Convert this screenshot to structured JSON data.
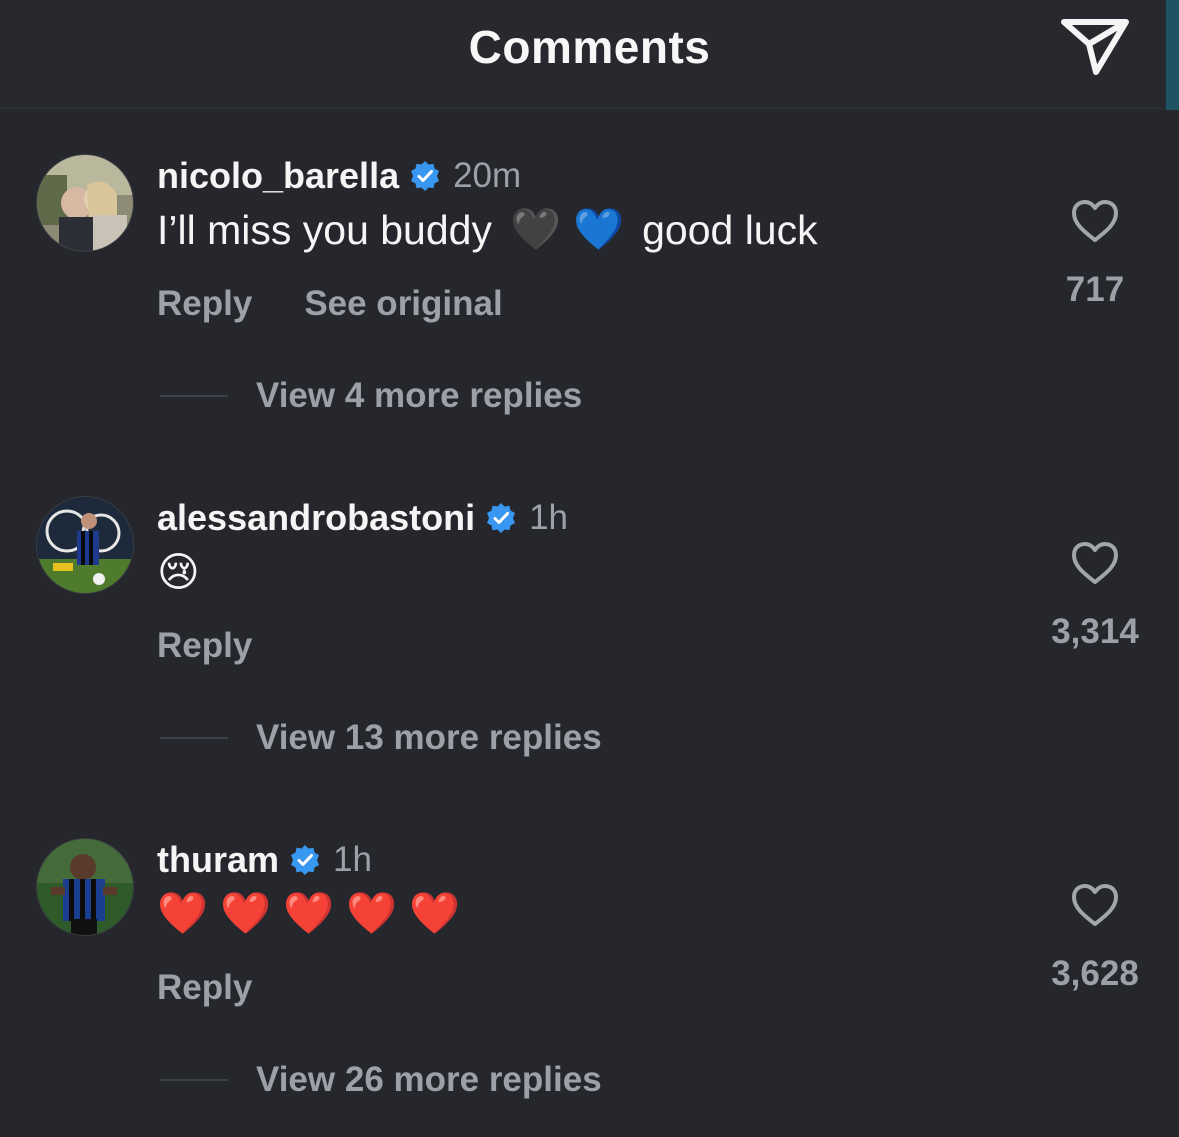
{
  "header": {
    "title": "Comments",
    "share_icon": "paper-plane-icon"
  },
  "colors": {
    "background": "#25272c",
    "muted_text": "#9da1a7",
    "verified_blue": "#3897f0",
    "text": "#f5f5f5"
  },
  "comments": [
    {
      "username": "nicolo_barella",
      "verified": true,
      "time": "20m",
      "text": "I’ll miss you buddy",
      "emojis": [
        "🖤",
        "💙"
      ],
      "text_after": "good luck",
      "actions": {
        "reply": "Reply",
        "see_original": "See original"
      },
      "likes": "717",
      "view_replies": "View 4 more replies",
      "avatar_icon": "profile-photo"
    },
    {
      "username": "alessandrobastoni",
      "verified": true,
      "time": "1h",
      "text": "",
      "emojis": [
        "😢"
      ],
      "actions": {
        "reply": "Reply"
      },
      "likes": "3,314",
      "view_replies": "View 13 more replies",
      "avatar_icon": "profile-photo"
    },
    {
      "username": "thuram",
      "verified": true,
      "time": "1h",
      "text": "",
      "emojis": [
        "❤️",
        "❤️",
        "❤️",
        "❤️",
        "❤️"
      ],
      "actions": {
        "reply": "Reply"
      },
      "likes": "3,628",
      "view_replies": "View 26 more replies",
      "avatar_icon": "profile-photo"
    }
  ]
}
